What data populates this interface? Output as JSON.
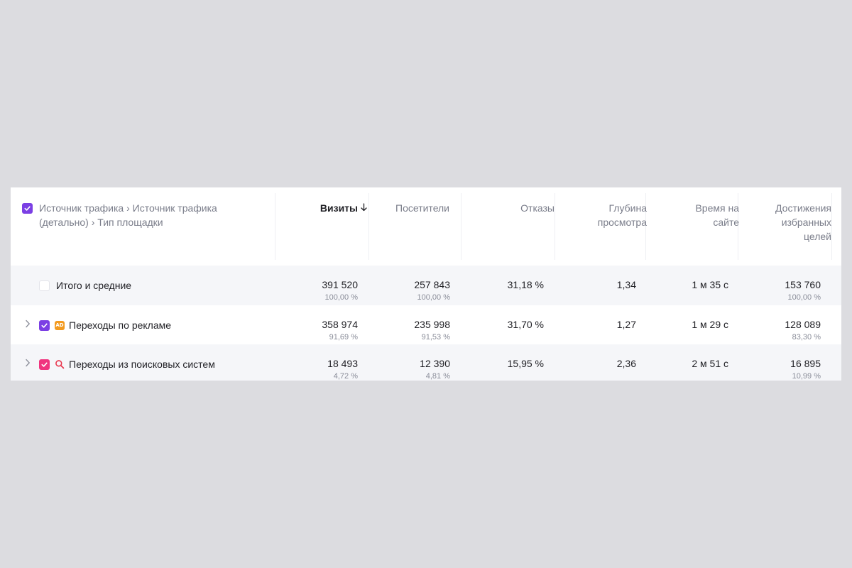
{
  "colors": {
    "background": "#dcdce0",
    "panel": "#ffffff",
    "stripe": "#f5f6f9",
    "checkbox_purple": "#7b3fe4",
    "checkbox_pink": "#f0357f",
    "ad_badge": "#f39a1e",
    "search_icon": "#e8384f",
    "text_primary": "#1f1f24",
    "text_secondary": "#7a7d8a"
  },
  "header": {
    "dimensions": "Источник трафика › Источник трафика (детально) › Тип площадки",
    "columns": {
      "visits": "Визиты",
      "visits_sort_icon": "arrow-down-icon",
      "users": "Посетители",
      "bounce": "Отказы",
      "depth": "Глубина просмотра",
      "time": "Время на сайте",
      "goals": "Достижения избранных целей"
    }
  },
  "rows": [
    {
      "label": "Итого и средние",
      "checkbox": "empty",
      "icon": "none",
      "expandable": false,
      "visits": "391 520",
      "visits_pct": "100,00 %",
      "users": "257 843",
      "users_pct": "100,00 %",
      "bounce": "31,18 %",
      "depth": "1,34",
      "time": "1 м 35 с",
      "goals": "153 760",
      "goals_pct": "100,00 %"
    },
    {
      "label": "Переходы по рекламе",
      "checkbox": "purple",
      "icon": "ad-icon",
      "icon_text": "AD",
      "expandable": true,
      "visits": "358 974",
      "visits_pct": "91,69 %",
      "users": "235 998",
      "users_pct": "91,53 %",
      "bounce": "31,70 %",
      "depth": "1,27",
      "time": "1 м 29 с",
      "goals": "128 089",
      "goals_pct": "83,30 %"
    },
    {
      "label": "Переходы из поисковых систем",
      "checkbox": "pink",
      "icon": "search-icon",
      "expandable": true,
      "visits": "18 493",
      "visits_pct": "4,72 %",
      "users": "12 390",
      "users_pct": "4,81 %",
      "bounce": "15,95 %",
      "depth": "2,36",
      "time": "2 м 51 с",
      "goals": "16 895",
      "goals_pct": "10,99 %"
    }
  ]
}
